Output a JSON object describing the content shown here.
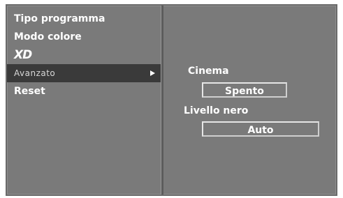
{
  "menu": {
    "items": [
      {
        "label": "Tipo programma"
      },
      {
        "label": "Modo colore"
      },
      {
        "label": "XD"
      },
      {
        "label": "Avanzato"
      },
      {
        "label": "Reset"
      }
    ],
    "selected_index": 3
  },
  "submenu": {
    "cinema": {
      "label": "Cinema",
      "value": "Spento"
    },
    "livello_nero": {
      "label": "Livello nero",
      "value": "Auto"
    }
  },
  "colors": {
    "panel_bg": "#7a7a7a",
    "selected_bg": "#3a3a3a",
    "text": "#ffffff"
  }
}
